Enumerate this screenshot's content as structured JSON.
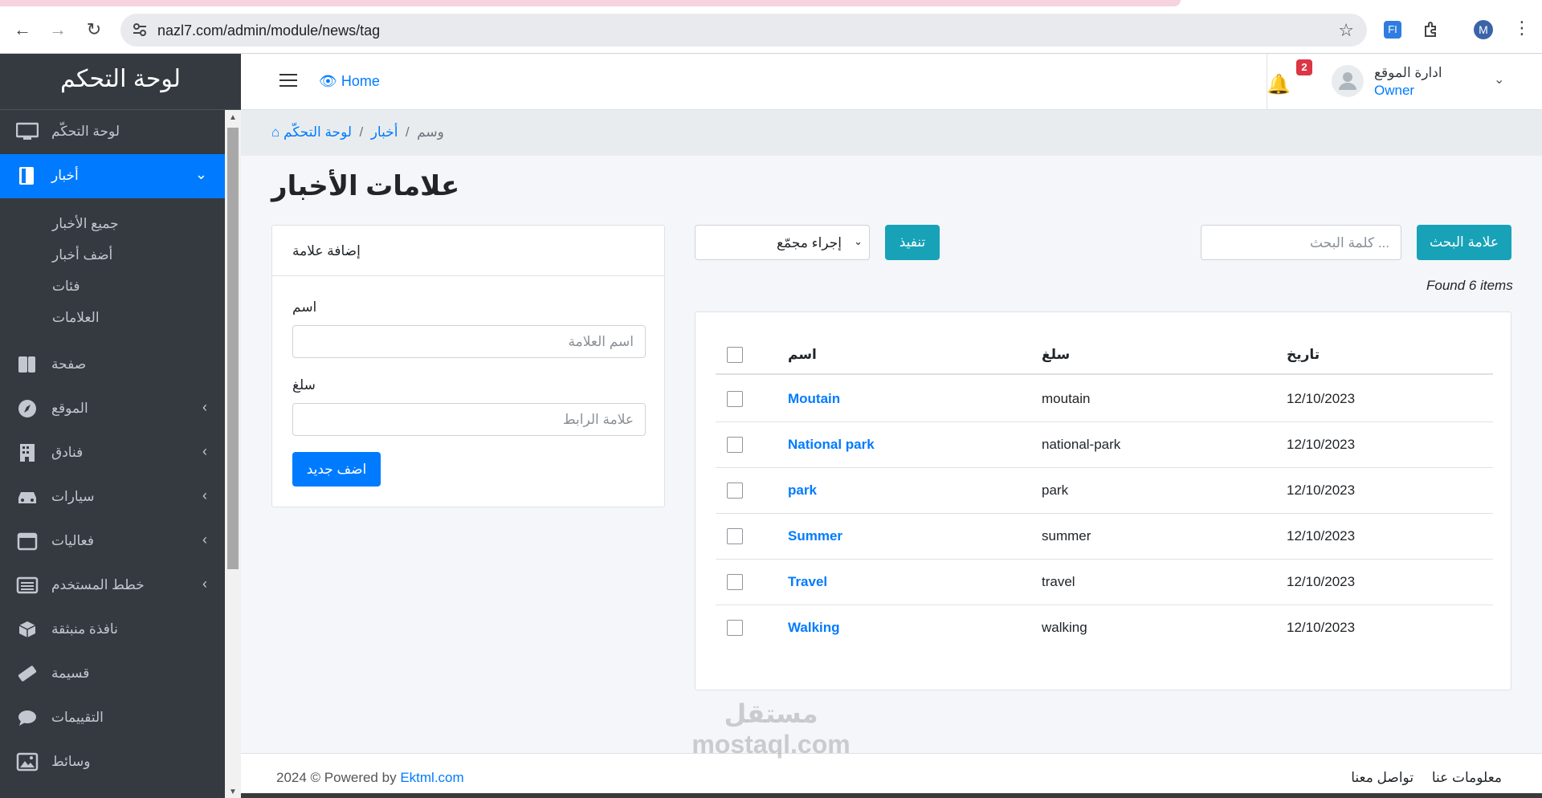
{
  "browser": {
    "url": "nazl7.com/admin/module/news/tag",
    "back_icon": "←",
    "forward_icon": "→",
    "reload_icon": "↻",
    "star_icon": "☆",
    "profile_initial": "M",
    "ext_label": "FI",
    "kebab_icon": "⋮"
  },
  "sidebar": {
    "brand": "لوحة التحكم",
    "items": [
      {
        "label": "لوحة التحكّم"
      },
      {
        "label": "أخبار",
        "chevron": "⌄"
      },
      {
        "label": "صفحة"
      },
      {
        "label": "الموقع",
        "chevron": "‹"
      },
      {
        "label": "فنادق",
        "chevron": "‹"
      },
      {
        "label": "سيارات",
        "chevron": "‹"
      },
      {
        "label": "فعاليات",
        "chevron": "‹"
      },
      {
        "label": "خطط المستخدم",
        "chevron": "‹"
      },
      {
        "label": "نافذة منبثقة"
      },
      {
        "label": "قسيمة"
      },
      {
        "label": "التقييمات"
      },
      {
        "label": "وسائط"
      }
    ],
    "news_sub": [
      "جميع الأخبار",
      "أضف أخبار",
      "فئات",
      "العلامات"
    ]
  },
  "topbar": {
    "home_label": "Home",
    "home_icon": "👁",
    "bell_icon": "🔔",
    "notif_count": "2",
    "user_name": "ادارة الموقع",
    "user_role": "Owner",
    "user_chevron": "⌄"
  },
  "breadcrumb": {
    "home_icon": "⌂",
    "dashboard": "لوحة التحكّم",
    "news": "أخبار",
    "current": "وسم",
    "sep": "/"
  },
  "page_title": "علامات الأخبار",
  "add_form": {
    "title": "إضافة علامة",
    "name_label": "اسم",
    "name_placeholder": "اسم العلامة",
    "slug_label": "سلغ",
    "slug_placeholder": "علامة الرابط",
    "submit": "اضف جديد"
  },
  "toolbar": {
    "bulk_action": "إجراء مجمّع",
    "bulk_chevron": "⌄",
    "apply": "تنفيذ",
    "search_placeholder": "... كلمة البحث",
    "search_button": "علامة البحث",
    "found": "Found 6 items"
  },
  "table": {
    "headers": {
      "name": "اسم",
      "slug": "سلغ",
      "date": "تاريخ"
    },
    "rows": [
      {
        "name": "Moutain",
        "slug": "moutain",
        "date": "12/10/2023"
      },
      {
        "name": "National park",
        "slug": "national-park",
        "date": "12/10/2023"
      },
      {
        "name": "park",
        "slug": "park",
        "date": "12/10/2023"
      },
      {
        "name": "Summer",
        "slug": "summer",
        "date": "12/10/2023"
      },
      {
        "name": "Travel",
        "slug": "travel",
        "date": "12/10/2023"
      },
      {
        "name": "Walking",
        "slug": "walking",
        "date": "12/10/2023"
      }
    ]
  },
  "footer": {
    "copyright": "2024 © Powered by",
    "brand_link": "Ektml.com",
    "about": "معلومات عنا",
    "contact": "تواصل معنا"
  },
  "watermark": {
    "line1": "مستقل",
    "line2": "mostaql.com"
  }
}
